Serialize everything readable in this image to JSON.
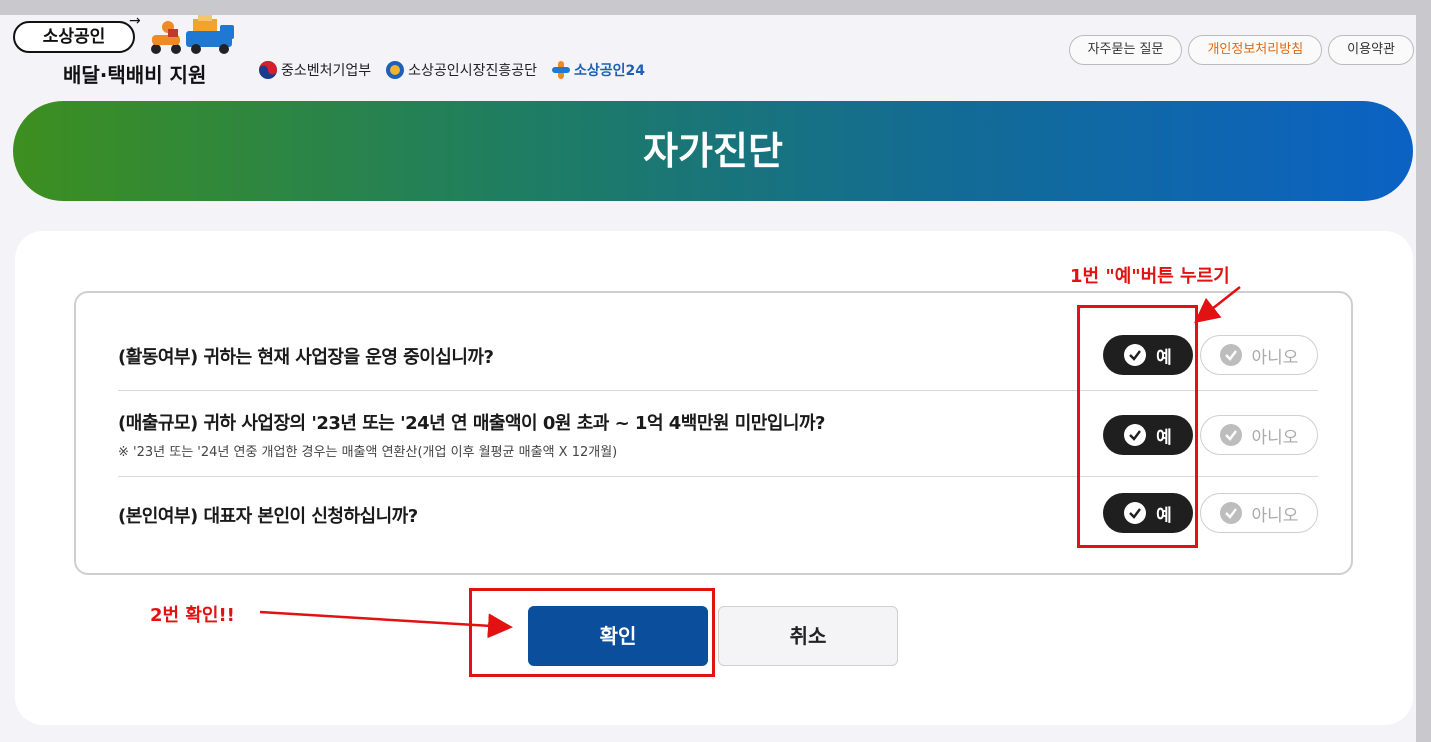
{
  "header": {
    "brand_pill": "소상공인",
    "brand_sub": "배달·택배비 지원",
    "orgs": [
      "중소벤처기업부",
      "소상공인시장진흥공단",
      "소상공인24"
    ],
    "links": [
      "자주묻는 질문",
      "개인정보처리방침",
      "이용약관"
    ]
  },
  "banner": {
    "title": "자가진단"
  },
  "questions": [
    {
      "text": "(활동여부) 귀하는 현재 사업장을 운영 중이십니까?",
      "note": ""
    },
    {
      "text": "(매출규모) 귀하 사업장의 '23년 또는 '24년 연 매출액이 0원 초과 ~ 1억 4백만원 미만입니까?",
      "note": "※ '23년 또는 '24년 연중 개업한 경우는 매출액 연환산(개업 이후 월평균 매출액 X 12개월)"
    },
    {
      "text": "(본인여부) 대표자 본인이 신청하십니까?",
      "note": ""
    }
  ],
  "answers": {
    "yes": "예",
    "no": "아니오"
  },
  "actions": {
    "confirm": "확인",
    "cancel": "취소"
  },
  "annotations": {
    "step1": "1번 \"예\"버튼 누르기",
    "step2": "2번 확인!!"
  },
  "colors": {
    "banner_start": "#3d8f1f",
    "banner_end": "#0b62c4",
    "confirm": "#0a4e9c",
    "selected": "#1f1f1f",
    "annotation": "#e31212",
    "privacy_link": "#e06a10"
  }
}
